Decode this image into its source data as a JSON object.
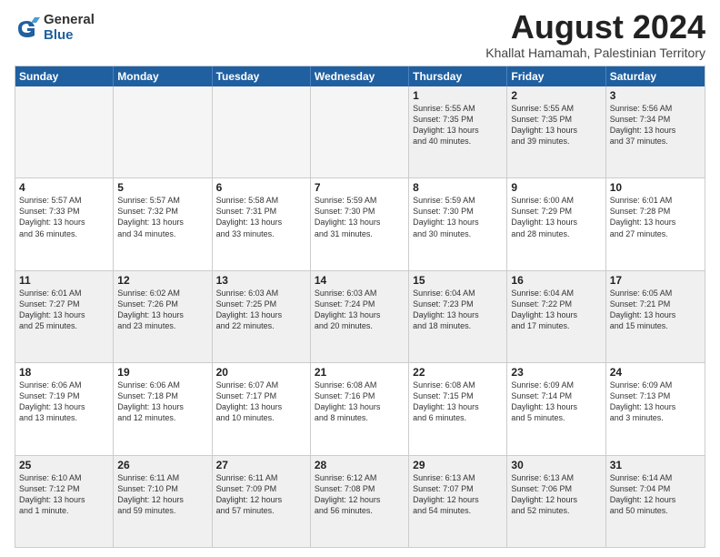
{
  "logo": {
    "general": "General",
    "blue": "Blue"
  },
  "header": {
    "month": "August 2024",
    "location": "Khallat Hamamah, Palestinian Territory"
  },
  "weekdays": [
    "Sunday",
    "Monday",
    "Tuesday",
    "Wednesday",
    "Thursday",
    "Friday",
    "Saturday"
  ],
  "rows": [
    [
      {
        "day": "",
        "info": "",
        "empty": true
      },
      {
        "day": "",
        "info": "",
        "empty": true
      },
      {
        "day": "",
        "info": "",
        "empty": true
      },
      {
        "day": "",
        "info": "",
        "empty": true
      },
      {
        "day": "1",
        "info": "Sunrise: 5:55 AM\nSunset: 7:35 PM\nDaylight: 13 hours\nand 40 minutes."
      },
      {
        "day": "2",
        "info": "Sunrise: 5:55 AM\nSunset: 7:35 PM\nDaylight: 13 hours\nand 39 minutes."
      },
      {
        "day": "3",
        "info": "Sunrise: 5:56 AM\nSunset: 7:34 PM\nDaylight: 13 hours\nand 37 minutes."
      }
    ],
    [
      {
        "day": "4",
        "info": "Sunrise: 5:57 AM\nSunset: 7:33 PM\nDaylight: 13 hours\nand 36 minutes."
      },
      {
        "day": "5",
        "info": "Sunrise: 5:57 AM\nSunset: 7:32 PM\nDaylight: 13 hours\nand 34 minutes."
      },
      {
        "day": "6",
        "info": "Sunrise: 5:58 AM\nSunset: 7:31 PM\nDaylight: 13 hours\nand 33 minutes."
      },
      {
        "day": "7",
        "info": "Sunrise: 5:59 AM\nSunset: 7:30 PM\nDaylight: 13 hours\nand 31 minutes."
      },
      {
        "day": "8",
        "info": "Sunrise: 5:59 AM\nSunset: 7:30 PM\nDaylight: 13 hours\nand 30 minutes."
      },
      {
        "day": "9",
        "info": "Sunrise: 6:00 AM\nSunset: 7:29 PM\nDaylight: 13 hours\nand 28 minutes."
      },
      {
        "day": "10",
        "info": "Sunrise: 6:01 AM\nSunset: 7:28 PM\nDaylight: 13 hours\nand 27 minutes."
      }
    ],
    [
      {
        "day": "11",
        "info": "Sunrise: 6:01 AM\nSunset: 7:27 PM\nDaylight: 13 hours\nand 25 minutes."
      },
      {
        "day": "12",
        "info": "Sunrise: 6:02 AM\nSunset: 7:26 PM\nDaylight: 13 hours\nand 23 minutes."
      },
      {
        "day": "13",
        "info": "Sunrise: 6:03 AM\nSunset: 7:25 PM\nDaylight: 13 hours\nand 22 minutes."
      },
      {
        "day": "14",
        "info": "Sunrise: 6:03 AM\nSunset: 7:24 PM\nDaylight: 13 hours\nand 20 minutes."
      },
      {
        "day": "15",
        "info": "Sunrise: 6:04 AM\nSunset: 7:23 PM\nDaylight: 13 hours\nand 18 minutes."
      },
      {
        "day": "16",
        "info": "Sunrise: 6:04 AM\nSunset: 7:22 PM\nDaylight: 13 hours\nand 17 minutes."
      },
      {
        "day": "17",
        "info": "Sunrise: 6:05 AM\nSunset: 7:21 PM\nDaylight: 13 hours\nand 15 minutes."
      }
    ],
    [
      {
        "day": "18",
        "info": "Sunrise: 6:06 AM\nSunset: 7:19 PM\nDaylight: 13 hours\nand 13 minutes."
      },
      {
        "day": "19",
        "info": "Sunrise: 6:06 AM\nSunset: 7:18 PM\nDaylight: 13 hours\nand 12 minutes."
      },
      {
        "day": "20",
        "info": "Sunrise: 6:07 AM\nSunset: 7:17 PM\nDaylight: 13 hours\nand 10 minutes."
      },
      {
        "day": "21",
        "info": "Sunrise: 6:08 AM\nSunset: 7:16 PM\nDaylight: 13 hours\nand 8 minutes."
      },
      {
        "day": "22",
        "info": "Sunrise: 6:08 AM\nSunset: 7:15 PM\nDaylight: 13 hours\nand 6 minutes."
      },
      {
        "day": "23",
        "info": "Sunrise: 6:09 AM\nSunset: 7:14 PM\nDaylight: 13 hours\nand 5 minutes."
      },
      {
        "day": "24",
        "info": "Sunrise: 6:09 AM\nSunset: 7:13 PM\nDaylight: 13 hours\nand 3 minutes."
      }
    ],
    [
      {
        "day": "25",
        "info": "Sunrise: 6:10 AM\nSunset: 7:12 PM\nDaylight: 13 hours\nand 1 minute."
      },
      {
        "day": "26",
        "info": "Sunrise: 6:11 AM\nSunset: 7:10 PM\nDaylight: 12 hours\nand 59 minutes."
      },
      {
        "day": "27",
        "info": "Sunrise: 6:11 AM\nSunset: 7:09 PM\nDaylight: 12 hours\nand 57 minutes."
      },
      {
        "day": "28",
        "info": "Sunrise: 6:12 AM\nSunset: 7:08 PM\nDaylight: 12 hours\nand 56 minutes."
      },
      {
        "day": "29",
        "info": "Sunrise: 6:13 AM\nSunset: 7:07 PM\nDaylight: 12 hours\nand 54 minutes."
      },
      {
        "day": "30",
        "info": "Sunrise: 6:13 AM\nSunset: 7:06 PM\nDaylight: 12 hours\nand 52 minutes."
      },
      {
        "day": "31",
        "info": "Sunrise: 6:14 AM\nSunset: 7:04 PM\nDaylight: 12 hours\nand 50 minutes."
      }
    ]
  ]
}
